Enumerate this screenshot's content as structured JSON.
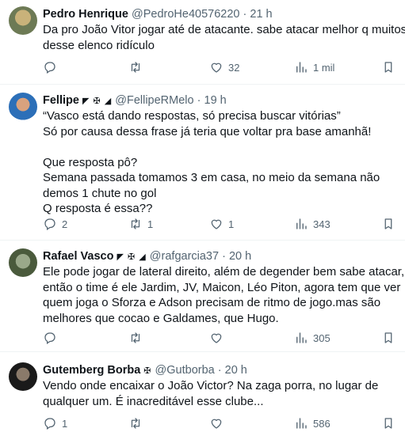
{
  "tweets": [
    {
      "name": "Pedro Henrique",
      "badges": "",
      "handle": "@PedroHe40576220",
      "dot": "·",
      "time": "21 h",
      "text": "Da pro João Vitor jogar até de atacante. sabe atacar melhor q muitos desse elenco ridículo",
      "replies": "",
      "retweets": "",
      "likes": "32",
      "views": "1 mil",
      "avatar_colors": [
        "#6d7a55",
        "#c9b27a"
      ]
    },
    {
      "name": "Fellipe",
      "badges": "◤ ✠ ◢",
      "handle": "@FellipeRMelo",
      "dot": "·",
      "time": "19 h",
      "text": "“Vasco está dando respostas, só precisa buscar vitórias”\nSó por causa dessa frase já teria que voltar pra base amanhã!\n\nQue resposta pô?\nSemana passada tomamos 3 em casa, no meio da semana não demos 1 chute no gol\nQ resposta é essa??",
      "replies": "2",
      "retweets": "1",
      "likes": "1",
      "views": "343",
      "avatar_colors": [
        "#2c6fb8",
        "#d9a27e"
      ]
    },
    {
      "name": "Rafael Vasco",
      "badges": "◤ ✠ ◢",
      "handle": "@rafgarcia37",
      "dot": "·",
      "time": "20 h",
      "text": "Ele pode jogar de lateral direito, além de degender bem sabe atacar, então o time é ele Jardim, JV, Maicon, Léo Piton, agora tem que ver quem joga o Sforza e Adson precisam de ritmo de jogo.mas são melhores que cocao e Galdames, que Hugo.",
      "replies": "",
      "retweets": "",
      "likes": "",
      "views": "305",
      "avatar_colors": [
        "#4a5a3c",
        "#9aa88a"
      ]
    },
    {
      "name": "Gutemberg Borba",
      "badges": "✠",
      "handle": "@Gutborba",
      "dot": "·",
      "time": "20 h",
      "text": "Vendo onde encaixar o João Victor? Na zaga porra, no lugar de qualquer um. É inacreditável esse clube...",
      "replies": "1",
      "retweets": "",
      "likes": "",
      "views": "586",
      "avatar_colors": [
        "#1a1a1a",
        "#8a7a6a"
      ]
    }
  ],
  "icons": {
    "reply": "reply-icon",
    "retweet": "retweet-icon",
    "like": "like-icon",
    "views": "views-icon",
    "bookmark": "bookmark-icon"
  }
}
